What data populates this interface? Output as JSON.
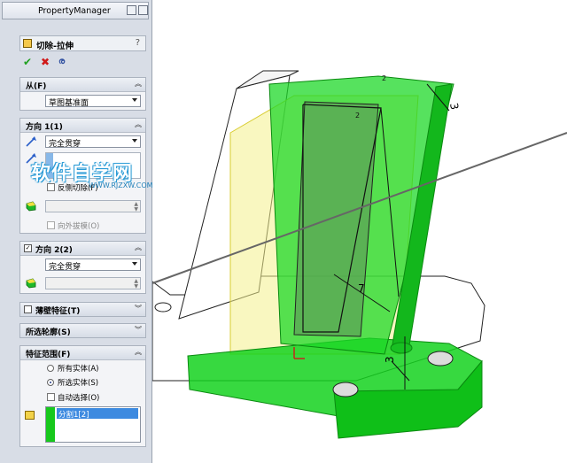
{
  "panel": {
    "title": "PropertyManager",
    "feature_name": "切除-拉伸",
    "help": "?",
    "from": {
      "header": "从(F)",
      "value": "草图基准面"
    },
    "direction1": {
      "header": "方向 1(1)",
      "end_condition": "完全贯穿",
      "reverse_check": "反侧切除(F)",
      "draft_outward": "向外拔模(O)"
    },
    "direction2": {
      "header": "方向 2(2)",
      "end_condition": "完全贯穿"
    },
    "thin_feature": {
      "header": "薄壁特征(T)"
    },
    "selected_contours": {
      "header": "所选轮廓(S)"
    },
    "feature_scope": {
      "header": "特征范围(F)",
      "opt_all": "所有实体(A)",
      "opt_selected": "所选实体(S)",
      "auto_select": "自动选择(O)",
      "list_item": "分割1[2]"
    }
  },
  "watermark": {
    "main": "软件自学网",
    "sub": "WWW.RJZXW.COM"
  },
  "viewport": {
    "dim_top": "3",
    "dim_mid": "7",
    "dim_bottom": "3",
    "tag_1": "2",
    "tag_2": "2"
  },
  "colors": {
    "accent_green": "#14d21e",
    "preview_yellow": "#f4f08c",
    "panel_bg": "#d8dde6"
  }
}
